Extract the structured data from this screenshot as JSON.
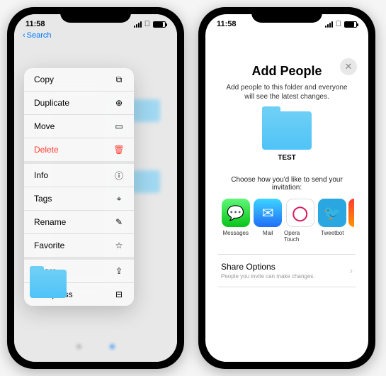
{
  "statusbar": {
    "time": "11:58",
    "back": "Search"
  },
  "contextMenu": {
    "items": [
      {
        "label": "Copy",
        "icon": "copy-icon"
      },
      {
        "label": "Duplicate",
        "icon": "duplicate-icon"
      },
      {
        "label": "Move",
        "icon": "folder-icon"
      },
      {
        "label": "Delete",
        "icon": "trash-icon",
        "destructive": true,
        "sepAfter": true
      },
      {
        "label": "Info",
        "icon": "info-icon"
      },
      {
        "label": "Tags",
        "icon": "tag-icon"
      },
      {
        "label": "Rename",
        "icon": "pencil-icon"
      },
      {
        "label": "Favorite",
        "icon": "star-icon",
        "sepAfter": true
      },
      {
        "label": "Share",
        "icon": "share-icon"
      },
      {
        "label": "Compress",
        "icon": "archive-icon"
      }
    ]
  },
  "sheet": {
    "title": "Add People",
    "subtitle": "Add people to this folder and everyone will see the latest changes.",
    "folderName": "TEST",
    "inviteLabel": "Choose how you'd like to send your invitation:",
    "apps": [
      {
        "name": "Messages",
        "bg": "linear-gradient(180deg,#5ff777,#09c41a)",
        "glyph": "💬"
      },
      {
        "name": "Mail",
        "bg": "linear-gradient(180deg,#3ed4ff,#1f6ef7)",
        "glyph": "✉︎"
      },
      {
        "name": "Opera Touch",
        "bg": "#fff",
        "glyph": "◯"
      },
      {
        "name": "Tweetbot",
        "bg": "#2aa7e0",
        "glyph": "🐦"
      }
    ],
    "shareOptions": {
      "title": "Share Options",
      "subtitle": "People you invite can make changes."
    }
  },
  "iconGlyphs": {
    "copy-icon": "⧉",
    "duplicate-icon": "⊕",
    "folder-icon": "▭",
    "trash-icon": "🗑",
    "info-icon": "ⓘ",
    "tag-icon": "⌖",
    "pencil-icon": "✎",
    "star-icon": "☆",
    "share-icon": "⇪",
    "archive-icon": "⊟"
  }
}
